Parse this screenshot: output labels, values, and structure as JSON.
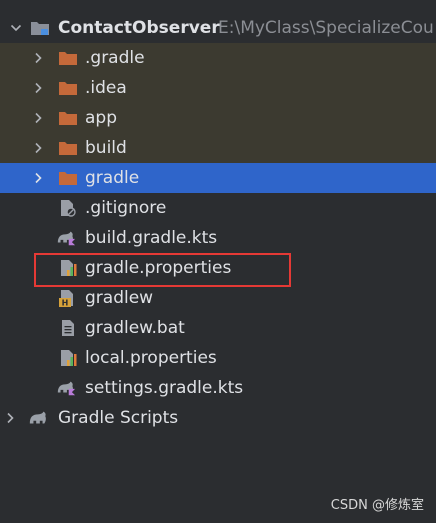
{
  "project": {
    "name": "ContactObserver",
    "path": "E:\\MyClass\\SpecializeCou"
  },
  "tree": {
    "folders": {
      "gradle_hidden": ".gradle",
      "idea": ".idea",
      "app": "app",
      "build": "build",
      "gradle": "gradle"
    },
    "files": {
      "gitignore": ".gitignore",
      "build_gradle_kts": "build.gradle.kts",
      "gradle_properties": "gradle.properties",
      "gradlew": "gradlew",
      "gradlew_bat": "gradlew.bat",
      "local_properties": "local.properties",
      "settings_gradle_kts": "settings.gradle.kts"
    },
    "gradle_scripts": "Gradle Scripts"
  },
  "watermark": "CSDN @修炼室",
  "colors": {
    "background": "#2b2d30",
    "selected_row": "#2f65ca",
    "changed_row": "#3c3a30",
    "folder": "#c4693a",
    "highlight_box": "#e53935"
  },
  "icons": {
    "expanded": "chevron-down-icon",
    "collapsed": "chevron-right-icon",
    "module": "module-folder-icon",
    "folder": "folder-icon",
    "ignore": "gitignore-file-icon",
    "gradle_kts": "gradle-kotlin-icon",
    "properties": "properties-file-icon",
    "shell": "shell-script-icon",
    "text": "text-file-icon",
    "elephant": "gradle-elephant-icon"
  }
}
